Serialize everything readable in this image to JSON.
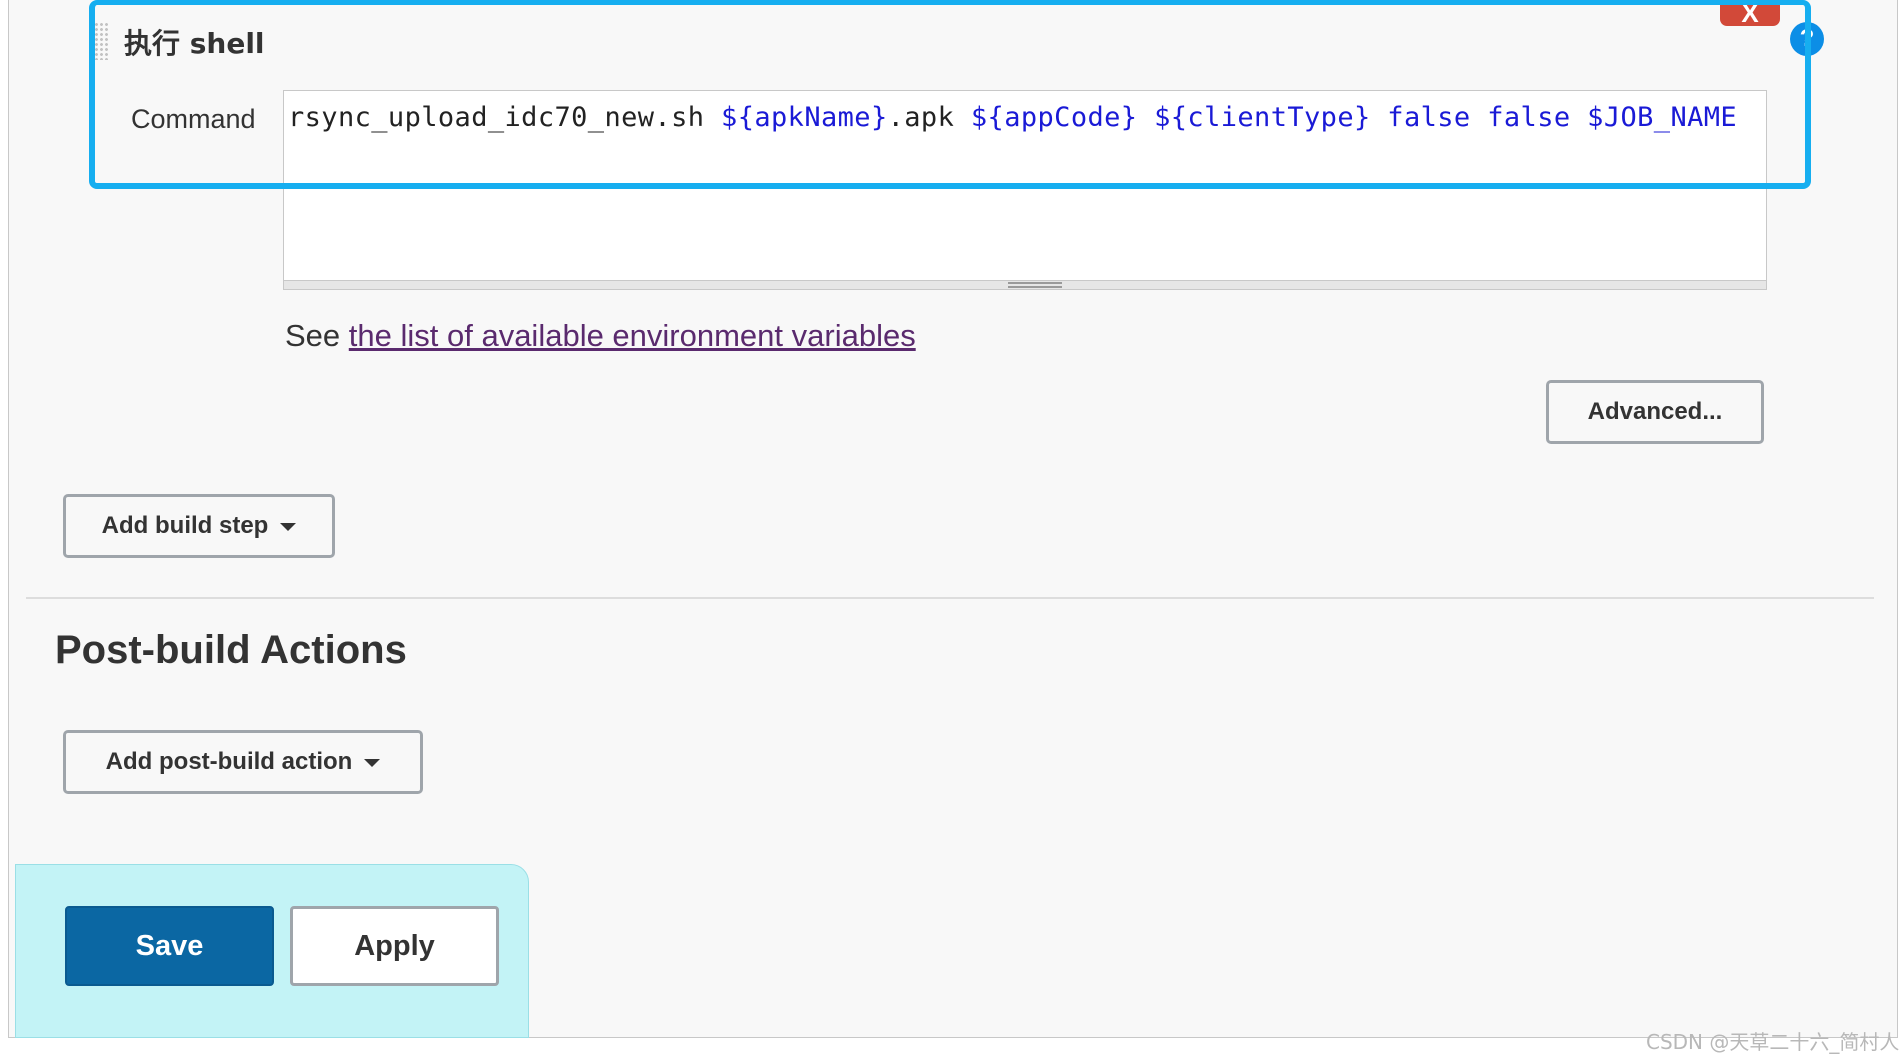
{
  "build_step": {
    "title": "执行 shell",
    "delete_label": "X",
    "help_label": "?",
    "command_label": "Command",
    "command_tokens": [
      {
        "text": "rsync_upload_idc70_new.sh ",
        "kind": "plain"
      },
      {
        "text": "${apkName}",
        "kind": "var"
      },
      {
        "text": ".apk ",
        "kind": "plain"
      },
      {
        "text": "${appCode}",
        "kind": "var"
      },
      {
        "text": " ",
        "kind": "plain"
      },
      {
        "text": "${clientType}",
        "kind": "var"
      },
      {
        "text": " false false ",
        "kind": "kw"
      },
      {
        "text": "$JOB_NAME",
        "kind": "var"
      }
    ],
    "env_prefix": "See ",
    "env_link": "the list of available environment variables",
    "advanced_label": "Advanced..."
  },
  "build_section": {
    "add_build_step_label": "Add build step"
  },
  "post_build": {
    "heading": "Post-build Actions",
    "add_action_label": "Add post-build action"
  },
  "footer": {
    "save_label": "Save",
    "apply_label": "Apply"
  },
  "watermark": "CSDN @天草二十六_简村人",
  "colors": {
    "highlight": "#16aef0",
    "save_bg": "#0b67a3",
    "bottom_bar_bg": "#c3f3f6",
    "delete_bg": "#d24939",
    "help_bg": "#0c8ee6",
    "variable_text": "#1a1ad6",
    "link": "#5a2a6e"
  }
}
